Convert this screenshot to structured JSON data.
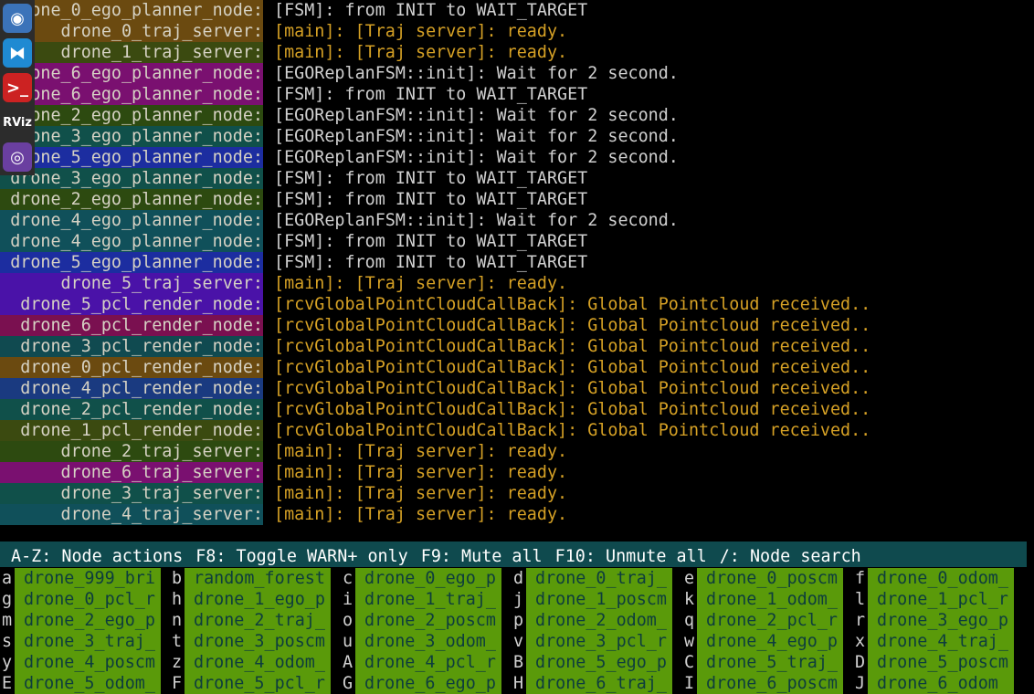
{
  "dock": {
    "items": [
      {
        "name": "chromium",
        "glyph": "◉",
        "color": "#3b73b9"
      },
      {
        "name": "vscode",
        "glyph": "⧓",
        "color": "#1f8ad2"
      },
      {
        "name": "terminal",
        "glyph": ">_",
        "color": "#cc2222"
      },
      {
        "name": "rviz",
        "glyph": "RViz",
        "color": "#2c2c2c"
      },
      {
        "name": "camera",
        "glyph": "◎",
        "color": "#6a3fa0"
      }
    ]
  },
  "log": [
    {
      "node": "drone_0_ego_planner_node:",
      "bg": "#6b4a10",
      "msg": "[FSM]: from INIT to WAIT_TARGET",
      "kind": "plain"
    },
    {
      "node": "drone_0_traj_server:",
      "bg": "#6b4a10",
      "msg": "[main]: [Traj server]: ready.",
      "kind": "info"
    },
    {
      "node": "drone_1_traj_server:",
      "bg": "#3b4a10",
      "msg": "[main]: [Traj server]: ready.",
      "kind": "info"
    },
    {
      "node": "drone_6_ego_planner_node:",
      "bg": "#7a1070",
      "msg": "[EGOReplanFSM::init]: Wait for 2 second.",
      "kind": "plain"
    },
    {
      "node": "drone_6_ego_planner_node:",
      "bg": "#7a1070",
      "msg": "[FSM]: from INIT to WAIT_TARGET",
      "kind": "plain"
    },
    {
      "node": "drone_2_ego_planner_node:",
      "bg": "#2d4a10",
      "msg": "[EGOReplanFSM::init]: Wait for 2 second.",
      "kind": "plain"
    },
    {
      "node": "drone_3_ego_planner_node:",
      "bg": "#10504a",
      "msg": "[EGOReplanFSM::init]: Wait for 2 second.",
      "kind": "plain"
    },
    {
      "node": "drone_5_ego_planner_node:",
      "bg": "#1c2da0",
      "msg": "[EGOReplanFSM::init]: Wait for 2 second.",
      "kind": "plain"
    },
    {
      "node": "drone_3_ego_planner_node:",
      "bg": "#10504a",
      "msg": "[FSM]: from INIT to WAIT_TARGET",
      "kind": "plain"
    },
    {
      "node": "drone_2_ego_planner_node:",
      "bg": "#2d4a10",
      "msg": "[FSM]: from INIT to WAIT_TARGET",
      "kind": "plain"
    },
    {
      "node": "drone_4_ego_planner_node:",
      "bg": "#10505a",
      "msg": "[EGOReplanFSM::init]: Wait for 2 second.",
      "kind": "plain"
    },
    {
      "node": "drone_4_ego_planner_node:",
      "bg": "#10505a",
      "msg": "[FSM]: from INIT to WAIT_TARGET",
      "kind": "plain"
    },
    {
      "node": "drone_5_ego_planner_node:",
      "bg": "#1c2da0",
      "msg": "[FSM]: from INIT to WAIT_TARGET",
      "kind": "plain"
    },
    {
      "node": "drone_5_traj_server:",
      "bg": "#4a12a8",
      "msg": "[main]: [Traj server]: ready.",
      "kind": "info"
    },
    {
      "node": "drone_5_pcl_render_node:",
      "bg": "#4a12a8",
      "msg": "[rcvGlobalPointCloudCallBack]: Global Pointcloud received..",
      "kind": "info"
    },
    {
      "node": "drone_6_pcl_render_node:",
      "bg": "#7a1050",
      "msg": "[rcvGlobalPointCloudCallBack]: Global Pointcloud received..",
      "kind": "info"
    },
    {
      "node": "drone_3_pcl_render_node:",
      "bg": "#104a50",
      "msg": "[rcvGlobalPointCloudCallBack]: Global Pointcloud received..",
      "kind": "info"
    },
    {
      "node": "drone_0_pcl_render_node:",
      "bg": "#6b4a10",
      "msg": "[rcvGlobalPointCloudCallBack]: Global Pointcloud received..",
      "kind": "info"
    },
    {
      "node": "drone_4_pcl_render_node:",
      "bg": "#1a3a80",
      "msg": "[rcvGlobalPointCloudCallBack]: Global Pointcloud received..",
      "kind": "info"
    },
    {
      "node": "drone_2_pcl_render_node:",
      "bg": "#10504a",
      "msg": "[rcvGlobalPointCloudCallBack]: Global Pointcloud received..",
      "kind": "info"
    },
    {
      "node": "drone_1_pcl_render_node:",
      "bg": "#3b4a10",
      "msg": "[rcvGlobalPointCloudCallBack]: Global Pointcloud received..",
      "kind": "info"
    },
    {
      "node": "drone_2_traj_server:",
      "bg": "#2d4a10",
      "msg": "[main]: [Traj server]: ready.",
      "kind": "info"
    },
    {
      "node": "drone_6_traj_server:",
      "bg": "#7a1070",
      "msg": "[main]: [Traj server]: ready.",
      "kind": "info"
    },
    {
      "node": "drone_3_traj_server:",
      "bg": "#10504a",
      "msg": "[main]: [Traj server]: ready.",
      "kind": "info"
    },
    {
      "node": "drone_4_traj_server:",
      "bg": "#10505a",
      "msg": "[main]: [Traj server]: ready.",
      "kind": "info"
    }
  ],
  "status_bar": [
    {
      "key": "A-Z:",
      "desc": "Node actions"
    },
    {
      "key": "F8:",
      "desc": "Toggle WARN+ only"
    },
    {
      "key": "F9:",
      "desc": "Mute all"
    },
    {
      "key": "F10:",
      "desc": "Unmute all"
    },
    {
      "key": "/:",
      "desc": "Node search"
    }
  ],
  "node_grid": [
    [
      {
        "key": "a",
        "label": "drone_999_bri"
      },
      {
        "key": "b",
        "label": "random_forest"
      },
      {
        "key": "c",
        "label": "drone_0_ego_p"
      },
      {
        "key": "d",
        "label": "drone_0_traj_"
      },
      {
        "key": "e",
        "label": "drone_0_poscm"
      },
      {
        "key": "f",
        "label": "drone_0_odom_"
      }
    ],
    [
      {
        "key": "g",
        "label": "drone_0_pcl_r"
      },
      {
        "key": "h",
        "label": "drone_1_ego_p"
      },
      {
        "key": "i",
        "label": "drone_1_traj_"
      },
      {
        "key": "j",
        "label": "drone_1_poscm"
      },
      {
        "key": "k",
        "label": "drone_1_odom_"
      },
      {
        "key": "l",
        "label": "drone_1_pcl_r"
      }
    ],
    [
      {
        "key": "m",
        "label": "drone_2_ego_p"
      },
      {
        "key": "n",
        "label": "drone_2_traj_"
      },
      {
        "key": "o",
        "label": "drone_2_poscm"
      },
      {
        "key": "p",
        "label": "drone_2_odom_"
      },
      {
        "key": "q",
        "label": "drone_2_pcl_r"
      },
      {
        "key": "r",
        "label": "drone_3_ego_p"
      }
    ],
    [
      {
        "key": "s",
        "label": "drone_3_traj_"
      },
      {
        "key": "t",
        "label": "drone_3_poscm"
      },
      {
        "key": "u",
        "label": "drone_3_odom_"
      },
      {
        "key": "v",
        "label": "drone_3_pcl_r"
      },
      {
        "key": "w",
        "label": "drone_4_ego_p"
      },
      {
        "key": "x",
        "label": "drone_4_traj_"
      }
    ],
    [
      {
        "key": "y",
        "label": "drone_4_poscm"
      },
      {
        "key": "z",
        "label": "drone_4_odom_"
      },
      {
        "key": "A",
        "label": "drone_4_pcl_r"
      },
      {
        "key": "B",
        "label": "drone_5_ego_p"
      },
      {
        "key": "C",
        "label": "drone_5_traj_"
      },
      {
        "key": "D",
        "label": "drone_5_poscm"
      }
    ],
    [
      {
        "key": "E",
        "label": "drone_5_odom_"
      },
      {
        "key": "F",
        "label": "drone_5_pcl_r"
      },
      {
        "key": "G",
        "label": "drone_6_ego_p"
      },
      {
        "key": "H",
        "label": "drone_6_traj_"
      },
      {
        "key": "I",
        "label": "drone_6_poscm"
      },
      {
        "key": "J",
        "label": "drone_6_odom"
      }
    ]
  ]
}
